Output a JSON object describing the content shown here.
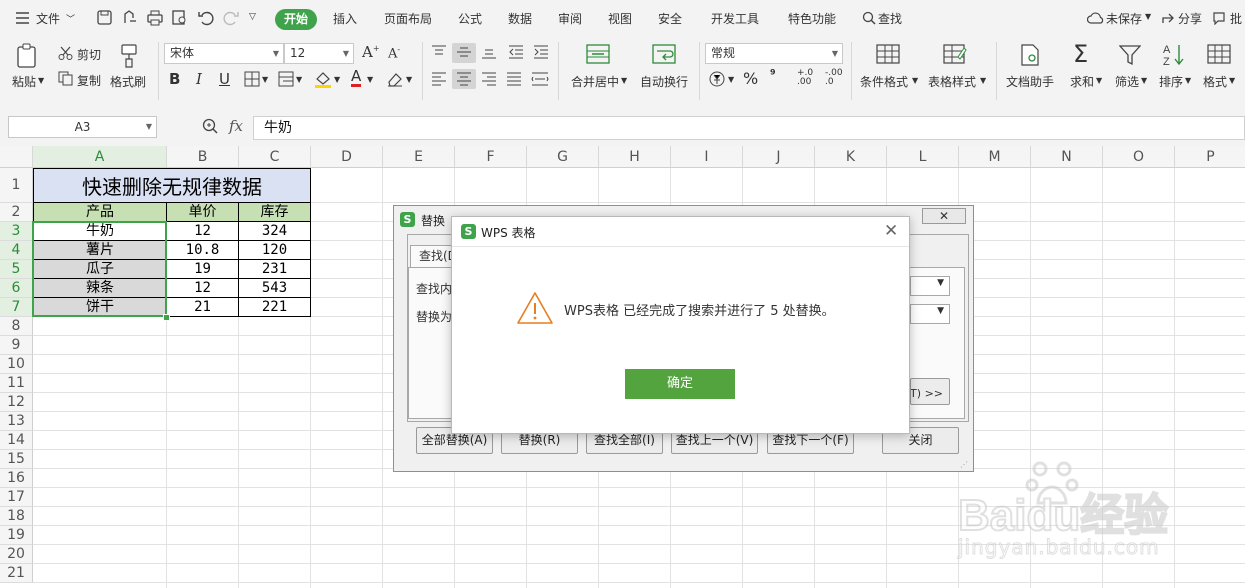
{
  "menubar": {
    "file": "文件",
    "tabs": [
      "开始",
      "插入",
      "页面布局",
      "公式",
      "数据",
      "审阅",
      "视图",
      "安全",
      "开发工具",
      "特色功能"
    ],
    "search": "查找",
    "unsaved": "未保存",
    "share": "分享",
    "comment": "批"
  },
  "ribbon": {
    "paste": "粘贴",
    "cut": "剪切",
    "copy": "复制",
    "format_painter": "格式刷",
    "font_name": "宋体",
    "font_size": "12",
    "merge_center": "合并居中",
    "wrap_text": "自动换行",
    "number_format": "常规",
    "conditional_format": "条件格式",
    "table_style": "表格样式",
    "doc_assistant": "文档助手",
    "sum": "求和",
    "filter": "筛选",
    "sort": "排序",
    "format": "格式"
  },
  "formula_bar": {
    "name_box": "A3",
    "fx": "fx",
    "value": "牛奶"
  },
  "sheet": {
    "columns": [
      "A",
      "B",
      "C",
      "D",
      "E",
      "F",
      "G",
      "H",
      "I",
      "J",
      "K",
      "L",
      "M",
      "N",
      "O",
      "P"
    ],
    "rows": [
      "1",
      "2",
      "3",
      "4",
      "5",
      "6",
      "7",
      "8",
      "9",
      "10",
      "11",
      "12",
      "13",
      "14",
      "15",
      "16",
      "17",
      "18",
      "19",
      "20",
      "21"
    ],
    "title": "快速删除无规律数据",
    "headers": [
      "产品",
      "单价",
      "库存"
    ],
    "data": [
      [
        "牛奶",
        "12",
        "324"
      ],
      [
        "薯片",
        "10.8",
        "120"
      ],
      [
        "瓜子",
        "19",
        "231"
      ],
      [
        "辣条",
        "12",
        "543"
      ],
      [
        "饼干",
        "21",
        "221"
      ]
    ]
  },
  "replace_dialog": {
    "title": "替换",
    "tab_find": "查找(D)",
    "find_label": "查找内容(N):",
    "replace_label": "替换为(E):",
    "options_btn": "选项(T) >>",
    "buttons": [
      "全部替换(A)",
      "替换(R)",
      "查找全部(I)",
      "查找上一个(V)",
      "查找下一个(F)",
      "关闭"
    ]
  },
  "message_dialog": {
    "title": "WPS 表格",
    "message": "WPS表格 已经完成了搜索并进行了 5 处替换。",
    "ok": "确定"
  },
  "watermark": {
    "brand": "Baidu经验",
    "url": "jingyan.baidu.com"
  },
  "colors": {
    "accent": "#3ea34a",
    "ok_button": "#53a43f",
    "title_fill": "#d9e1f2",
    "header_fill": "#c6e0b4",
    "selection": "#d9d9d9",
    "warning": "#e67e22"
  }
}
